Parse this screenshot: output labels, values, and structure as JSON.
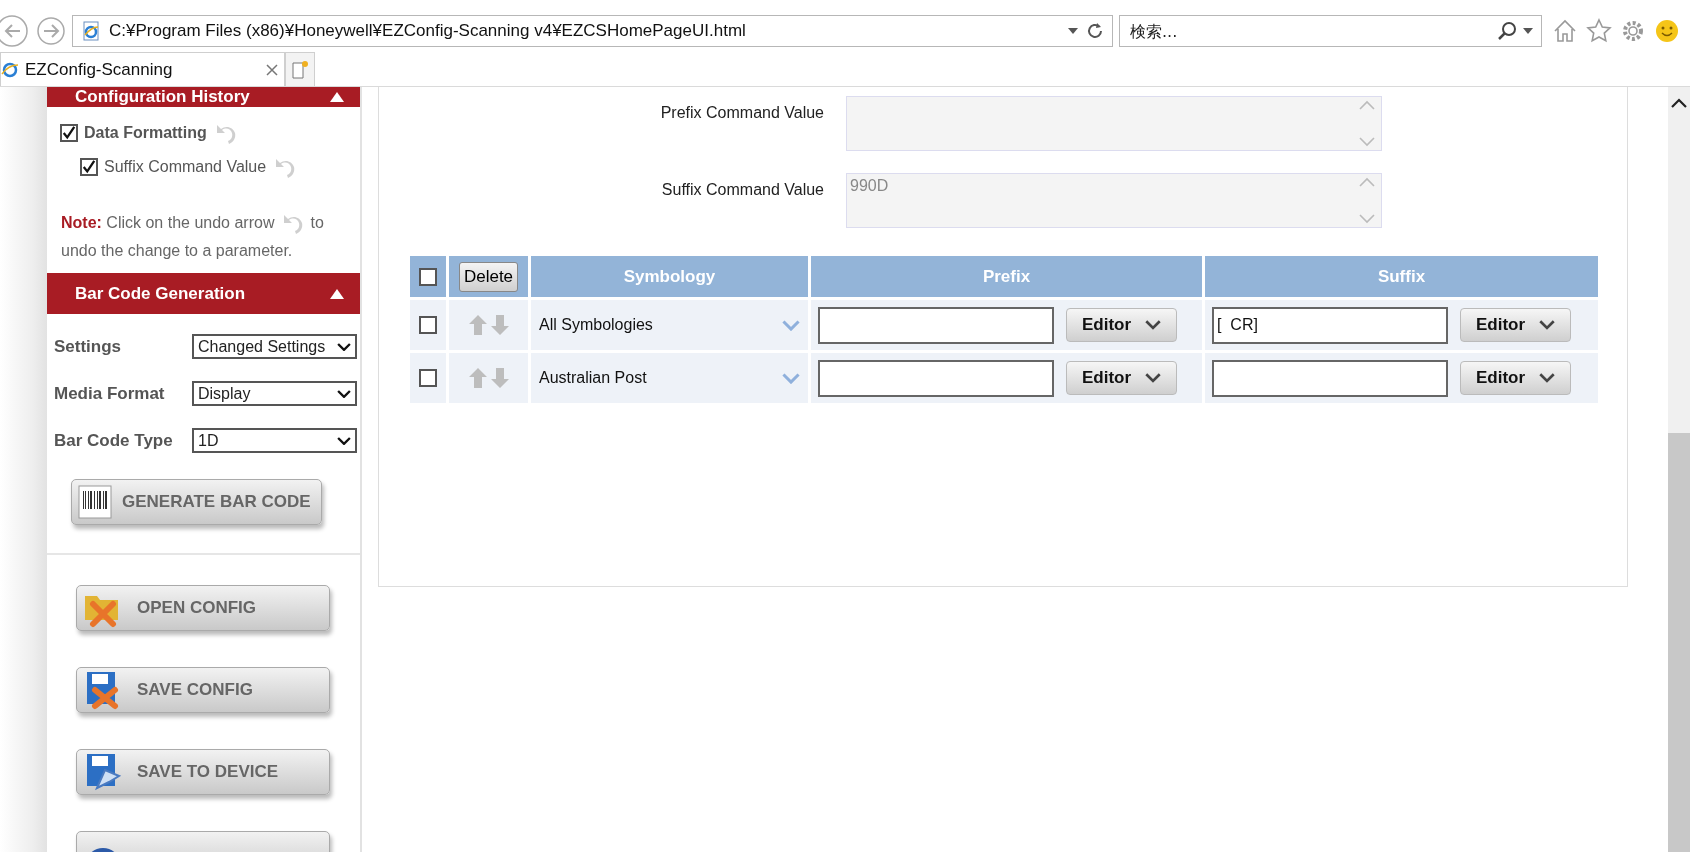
{
  "browser": {
    "address": "C:¥Program Files (x86)¥Honeywell¥EZConfig-Scanning v4¥EZCSHomePageUI.html",
    "search_placeholder": "検索...",
    "tabs": [
      {
        "title": "EZConfig-Scanning",
        "selected": true
      }
    ]
  },
  "sidebar": {
    "history": {
      "title": "Configuration History",
      "expanded": true,
      "items": [
        {
          "label": "Data Formatting",
          "checked": true,
          "children": [
            {
              "label": "Suffix Command Value",
              "checked": true
            }
          ]
        }
      ]
    },
    "note": {
      "label": "Note:",
      "before": "Click on the undo arrow",
      "after": "to",
      "continued": "undo the change to a parameter."
    },
    "barcode": {
      "title": "Bar Code Generation",
      "expanded": true,
      "fields": [
        {
          "label": "Settings",
          "value": "Changed Settings"
        },
        {
          "label": "Media Format",
          "value": "Display"
        },
        {
          "label": "Bar Code Type",
          "value": "1D"
        }
      ],
      "button": "GENERATE BAR CODE"
    },
    "actions": [
      {
        "label": "OPEN CONFIG",
        "kind": "open"
      },
      {
        "label": "SAVE CONFIG",
        "kind": "save"
      },
      {
        "label": "SAVE TO DEVICE",
        "kind": "device"
      },
      {
        "kind": "reset"
      }
    ]
  },
  "command_values": [
    {
      "label": "Prefix Command Value"
    },
    {
      "label": "Suffix Command Value",
      "value": "990D"
    }
  ],
  "table": {
    "select_all": false,
    "delete_button": "Delete",
    "columns": [
      "Symbology",
      "Prefix",
      "Suffix"
    ],
    "rows": [
      {
        "checked": false,
        "symbology": "All Symbologies",
        "suffix": "[  CR]",
        "prefix_button": "Editor",
        "suffix_button": "Editor"
      },
      {
        "checked": false,
        "symbology": "Australian Post",
        "prefix_button": "Editor",
        "suffix_button": "Editor"
      }
    ]
  }
}
